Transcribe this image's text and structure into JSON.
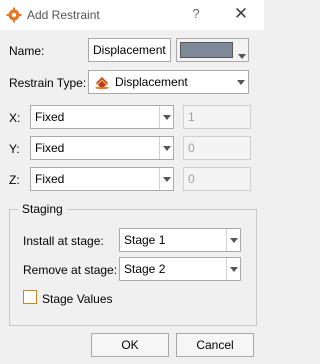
{
  "window": {
    "title": "Add Restraint",
    "help_label": "?",
    "close_label": "✕"
  },
  "name": {
    "label": "Name:",
    "value": "Displacement",
    "color": "#7e8a99"
  },
  "restrain_type": {
    "label": "Restrain Type:",
    "value": "Displacement"
  },
  "axes": [
    {
      "label": "X:",
      "value": "Fixed",
      "amount": "1"
    },
    {
      "label": "Y:",
      "value": "Fixed",
      "amount": "0"
    },
    {
      "label": "Z:",
      "value": "Fixed",
      "amount": "0"
    }
  ],
  "staging": {
    "title": "Staging",
    "install_label": "Install at stage:",
    "install_value": "Stage 1",
    "remove_label": "Remove at stage:",
    "remove_value": "Stage 2",
    "stage_values_label": "Stage Values",
    "stage_values_checked": false
  },
  "buttons": {
    "ok": "OK",
    "cancel": "Cancel"
  }
}
